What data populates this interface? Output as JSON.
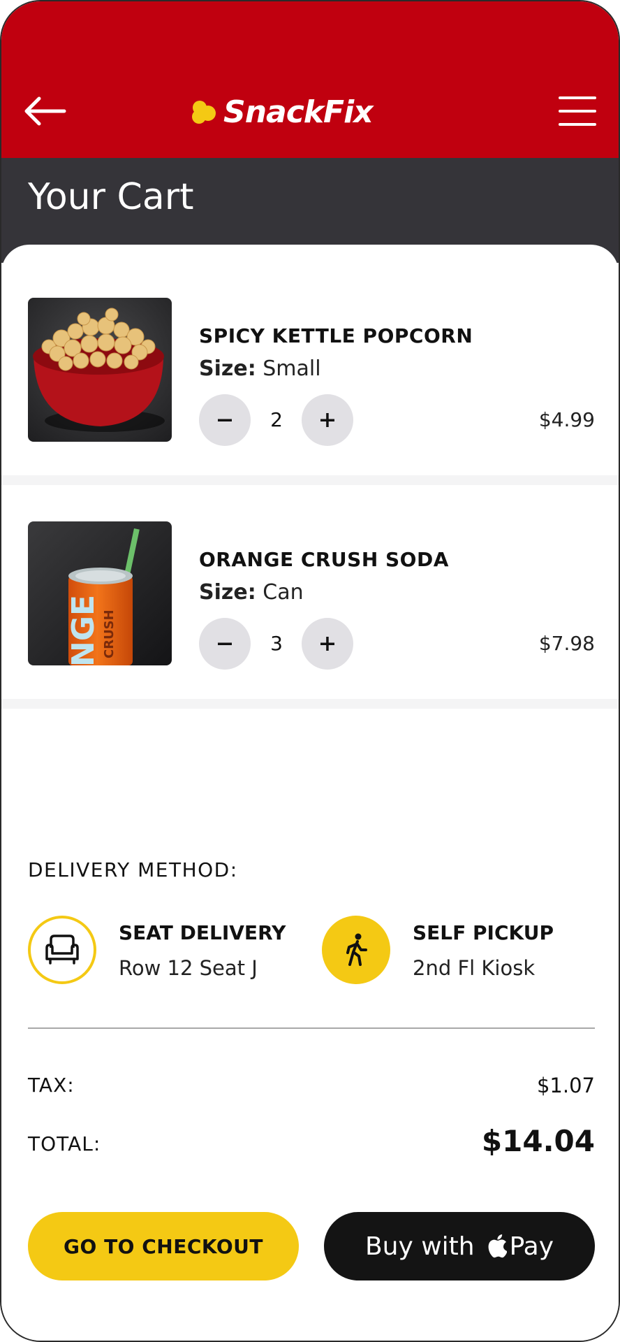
{
  "header": {
    "brand": "SnackFix",
    "title": "Your Cart",
    "back_icon": "arrow-left-icon",
    "menu_icon": "hamburger-menu-icon"
  },
  "cart": {
    "items": [
      {
        "name": "SPICY KETTLE POPCORN",
        "size_label": "Size:",
        "size_value": "Small",
        "quantity": "2",
        "price": "$4.99",
        "image": "popcorn-bowl-photo"
      },
      {
        "name": "ORANGE CRUSH SODA",
        "size_label": "Size:",
        "size_value": "Can",
        "quantity": "3",
        "price": "$7.98",
        "image": "orange-soda-can-photo",
        "can_text_large": "NGE",
        "can_text_small": "CRUSH"
      }
    ]
  },
  "delivery": {
    "label": "DELIVERY METHOD:",
    "options": [
      {
        "title": "SEAT DELIVERY",
        "subtitle": "Row 12 Seat J",
        "icon": "armchair-icon",
        "selected": false
      },
      {
        "title": "SELF PICKUP",
        "subtitle": "2nd Fl Kiosk",
        "icon": "walking-person-icon",
        "selected": true
      }
    ]
  },
  "summary": {
    "tax_label": "TAX:",
    "tax_value": "$1.07",
    "total_label": "TOTAL:",
    "total_value": "$14.04"
  },
  "actions": {
    "checkout_label": "GO TO CHECKOUT",
    "applepay_prefix": "Buy with",
    "applepay_suffix": "Pay"
  },
  "colors": {
    "brand_red": "#c0000f",
    "dark_bar": "#353439",
    "accent_yellow": "#f4c914",
    "stepper_grey": "#e1e0e4",
    "applepay_black": "#141414"
  }
}
